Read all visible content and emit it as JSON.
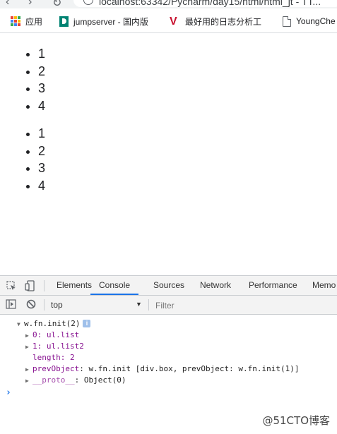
{
  "browser": {
    "url_partial": "localhost:63342/Pycharm/day15/html/html_jt - TT...",
    "bookmarks": [
      {
        "label": "应用",
        "icon": "apps-grid-icon"
      },
      {
        "label": "jumpserver - 国内版",
        "icon": "bing-icon"
      },
      {
        "label": "最好用的日志分析工",
        "icon": "v-logo-icon"
      },
      {
        "label": "YoungChe",
        "icon": "document-icon"
      }
    ]
  },
  "page": {
    "list1": [
      "1",
      "2",
      "3",
      "4"
    ],
    "list2": [
      "1",
      "2",
      "3",
      "4"
    ]
  },
  "devtools": {
    "tabs": [
      "Elements",
      "Console",
      "Sources",
      "Network",
      "Performance",
      "Memo"
    ],
    "active_tab": "Console",
    "context": "top",
    "filter_placeholder": "Filter",
    "console": {
      "root": "w.fn.init(2)",
      "info": "i",
      "rows": [
        {
          "key": "0",
          "value": "ul.list"
        },
        {
          "key": "1",
          "value": "ul.list2"
        },
        {
          "key": "length",
          "value": "2"
        },
        {
          "key": "prevObject",
          "value": "w.fn.init [div.box, prevObject: w.fn.init(1)]"
        },
        {
          "key": "__proto__",
          "value": "Object(0)"
        }
      ],
      "prompt": "›"
    }
  },
  "watermark": "@51CTO博客",
  "colors": {
    "accent": "#1a73e8",
    "console_key": "#881391",
    "chrome_bg": "#f3f3f3"
  }
}
